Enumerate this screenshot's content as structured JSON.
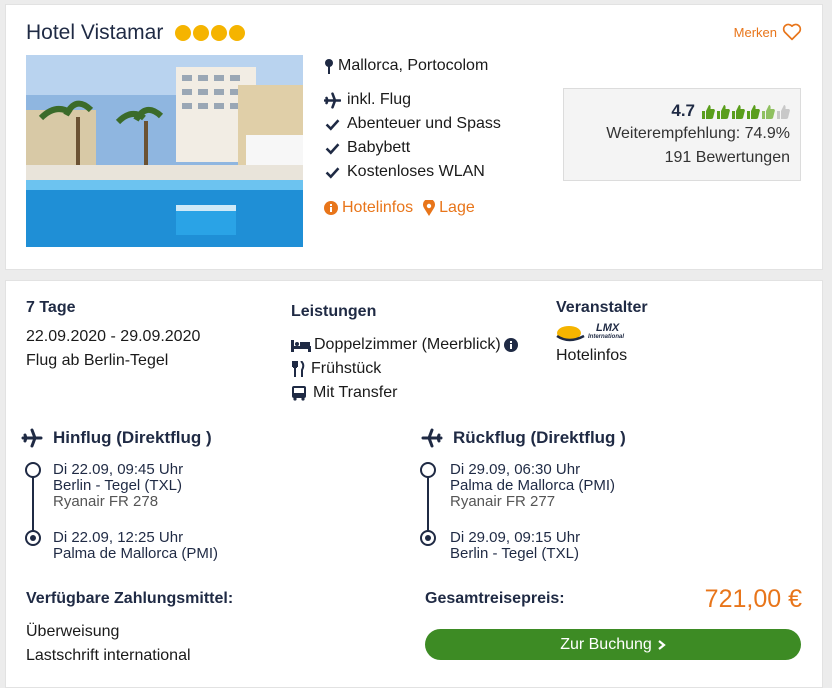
{
  "hotel": {
    "name": "Hotel Vistamar",
    "stars": 4,
    "merken_label": "Merken",
    "location": "Mallorca, Portocolom",
    "features": [
      "inkl. Flug",
      "Abenteuer und Spass",
      "Babybett",
      "Kostenloses WLAN"
    ],
    "links": {
      "hotelinfos": "Hotelinfos",
      "lage": "Lage"
    },
    "rating": {
      "score": "4.7",
      "recommendation": "Weiterempfehlung: 74.9%",
      "reviews": "191 Bewertungen",
      "thumbs_value": 4.7,
      "thumbs_max": 6
    }
  },
  "offer": {
    "duration": "7 Tage",
    "dates": "22.09.2020 - 29.09.2020",
    "departure": "Flug ab Berlin-Tegel",
    "services_title": "Leistungen",
    "services": [
      "Doppelzimmer (Meerblick)",
      "Frühstück",
      "Mit Transfer"
    ],
    "operator_title": "Veranstalter",
    "operator_logo_text": "LMX",
    "operator_logo_sub": "International",
    "operator_link": "Hotelinfos"
  },
  "outbound": {
    "title": "Hinflug (Direktflug )",
    "dep_time": "Di 22.09, 09:45 Uhr",
    "dep_place": "Berlin - Tegel (TXL)",
    "flight_no": "Ryanair FR 278",
    "arr_time": "Di 22.09, 12:25 Uhr",
    "arr_place": "Palma de Mallorca (PMI)"
  },
  "return": {
    "title": "Rückflug (Direktflug )",
    "dep_time": "Di 29.09, 06:30 Uhr",
    "dep_place": "Palma de Mallorca (PMI)",
    "flight_no": "Ryanair FR 277",
    "arr_time": "Di 29.09, 09:15 Uhr",
    "arr_place": "Berlin - Tegel (TXL)"
  },
  "payment": {
    "title": "Verfügbare Zahlungsmittel:",
    "methods": [
      "Überweisung",
      "Lastschrift international"
    ]
  },
  "pricing": {
    "label": "Gesamtreisepreis:",
    "total": "721,00 €",
    "book_label": "Zur Buchung"
  },
  "colors": {
    "accent": "#e8751a",
    "brand": "#1f2a44",
    "book": "#3d8b24",
    "star": "#f5b400",
    "thumb": "#5a9e1c"
  }
}
